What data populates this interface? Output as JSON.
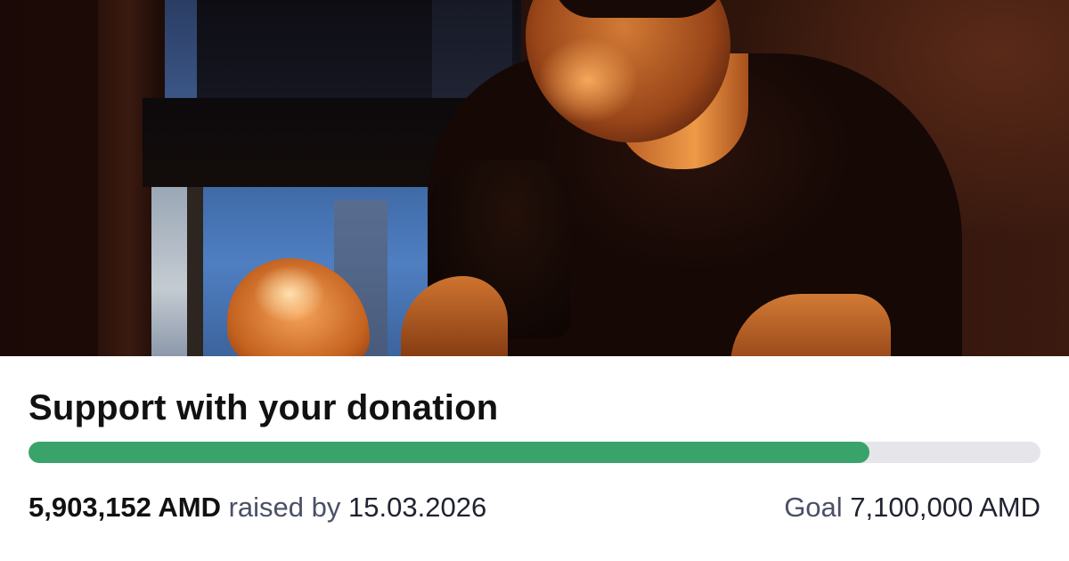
{
  "campaign": {
    "photo_alt": "Young man in a dark t-shirt sitting in warm light by a window",
    "title": "Support with your donation",
    "raised": {
      "amount": "5,903,152 AMD",
      "label": "raised by",
      "date": "15.03.2026"
    },
    "goal": {
      "label": "Goal",
      "amount": "7,100,000 AMD"
    },
    "progress_fraction": 0.8314,
    "colors": {
      "progress_fill": "#3aa36a",
      "progress_track": "#e6e6ea",
      "title_text": "#111111",
      "muted_text": "#4b5066"
    }
  }
}
